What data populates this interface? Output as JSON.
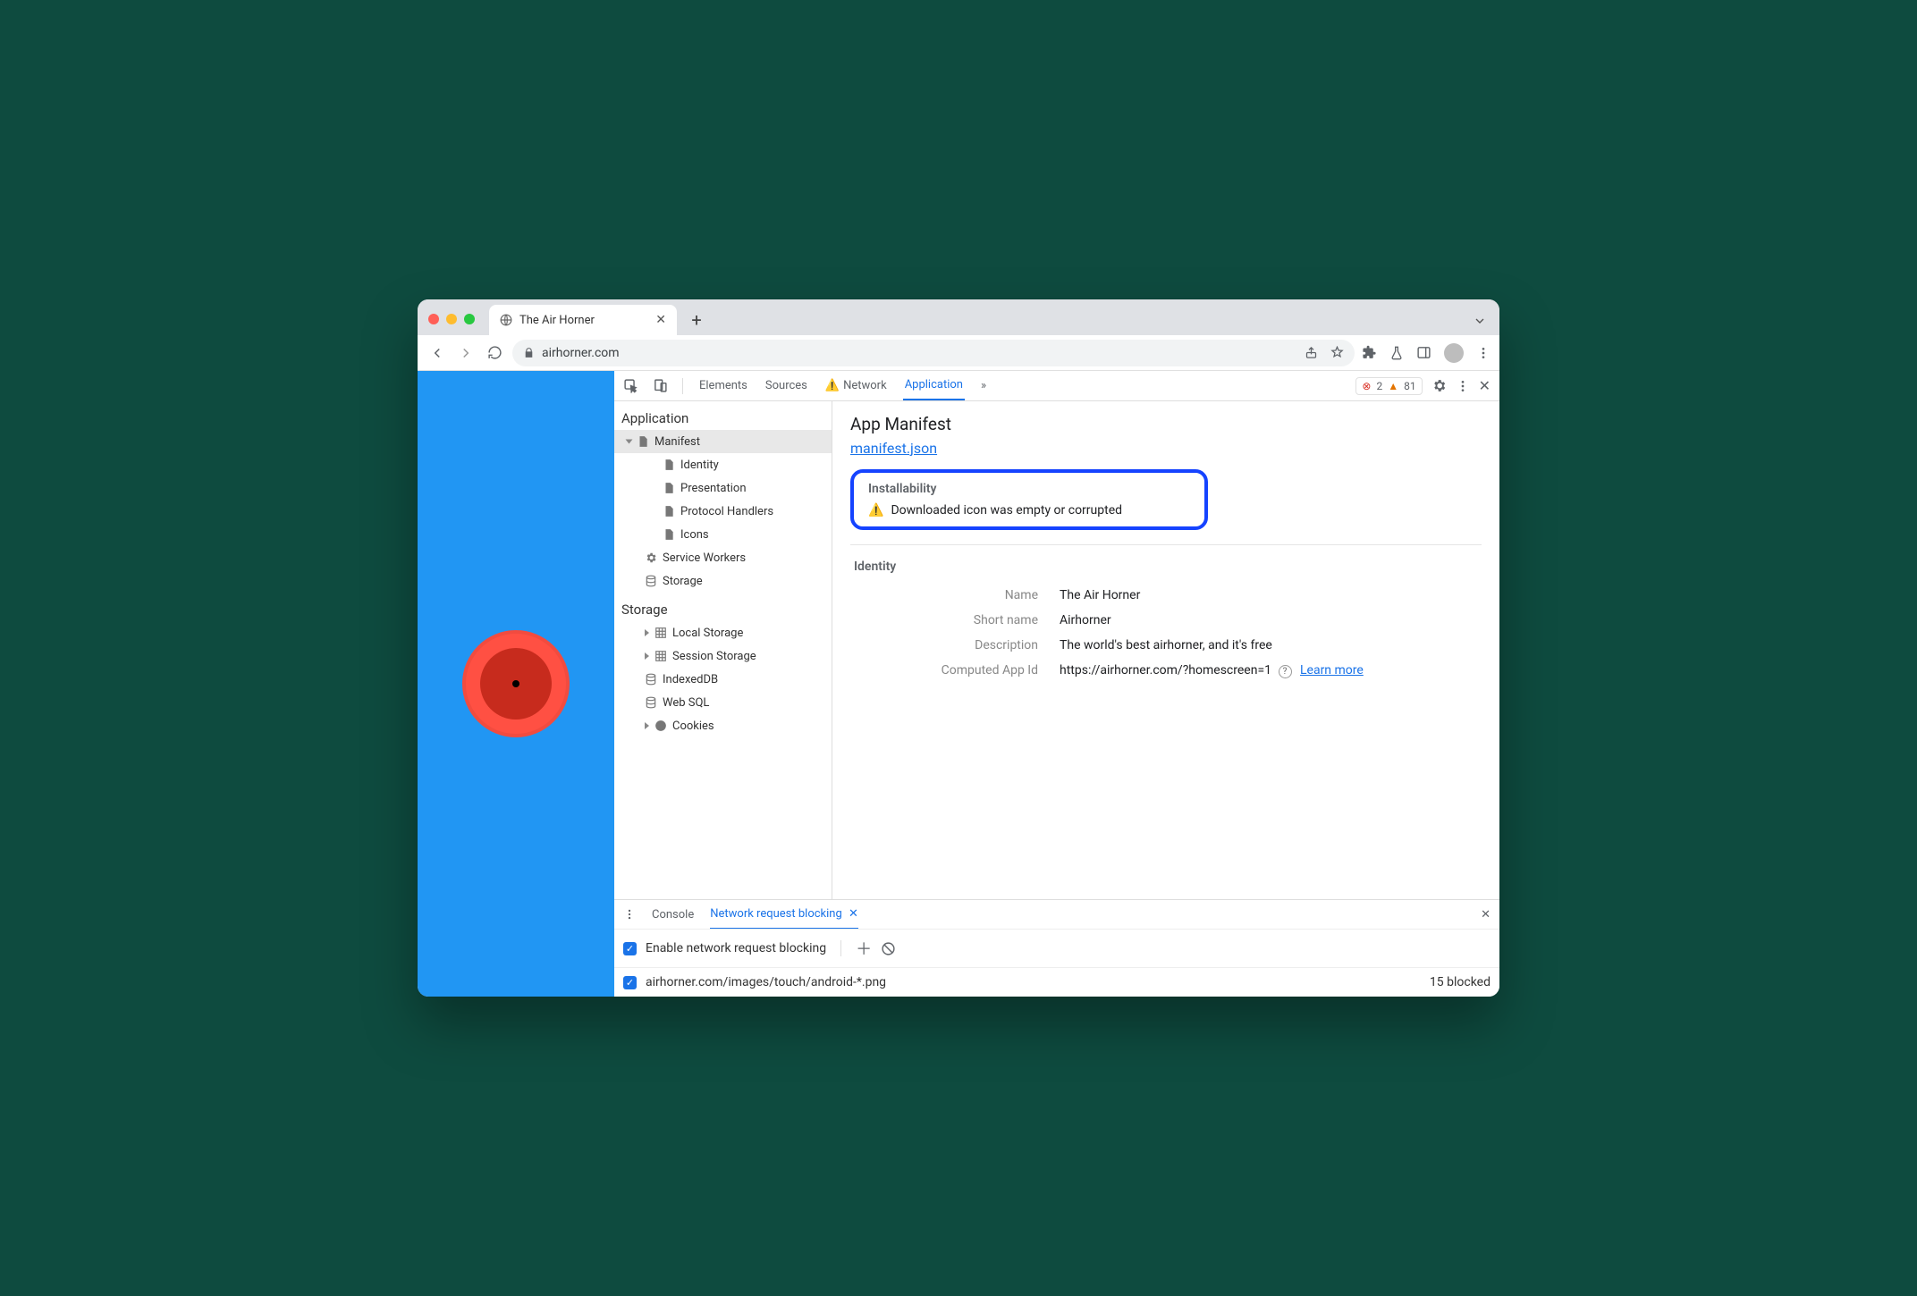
{
  "tab": {
    "title": "The Air Horner"
  },
  "address": {
    "host": "airhorner.com"
  },
  "toolbarCounts": {
    "errors": "2",
    "warnings": "81"
  },
  "devtoolsTabs": {
    "elements": "Elements",
    "sources": "Sources",
    "network": "Network",
    "application": "Application"
  },
  "sidebar": {
    "catApplication": "Application",
    "manifest": "Manifest",
    "identity": "Identity",
    "presentation": "Presentation",
    "protocolHandlers": "Protocol Handlers",
    "icons": "Icons",
    "serviceWorkers": "Service Workers",
    "storage": "Storage",
    "catStorage": "Storage",
    "localStorage": "Local Storage",
    "sessionStorage": "Session Storage",
    "indexedDB": "IndexedDB",
    "webSQL": "Web SQL",
    "cookies": "Cookies"
  },
  "panel": {
    "title": "App Manifest",
    "manifestLink": "manifest.json",
    "installability": "Installability",
    "installWarning": "Downloaded icon was empty or corrupted",
    "identityHeading": "Identity",
    "labels": {
      "name": "Name",
      "shortName": "Short name",
      "description": "Description",
      "computedAppId": "Computed App Id"
    },
    "values": {
      "name": "The Air Horner",
      "shortName": "Airhorner",
      "description": "The world's best airhorner, and it's free",
      "computedAppId": "https://airhorner.com/?homescreen=1"
    },
    "learnMore": "Learn more"
  },
  "drawer": {
    "consoleTab": "Console",
    "blockingTab": "Network request blocking",
    "enableLabel": "Enable network request blocking",
    "pattern": "airhorner.com/images/touch/android-*.png",
    "blockedLabel": "15 blocked"
  }
}
